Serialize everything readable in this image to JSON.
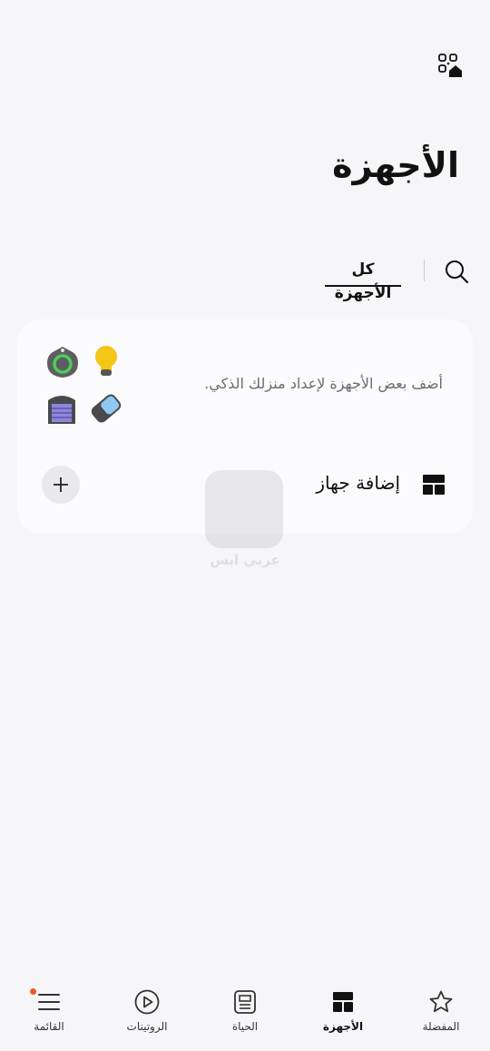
{
  "header": {
    "title": "الأجهزة",
    "qr_action_icon": "qr-home-icon",
    "search_icon": "search-icon"
  },
  "tabs": {
    "active_label": "كل الأجهزة"
  },
  "empty_card": {
    "hint": "أضف بعض الأجهزة لإعداد منزلك الذكي.",
    "device_icons": [
      "bulb-icon",
      "sensor-icon",
      "lock-card-icon",
      "garage-icon"
    ],
    "add_label": "إضافة جهاز",
    "add_icon": "devices-grid-icon",
    "plus_icon": "plus-icon"
  },
  "watermark": {
    "text": "عربي ابس"
  },
  "bottom_nav": {
    "items": [
      {
        "label": "المفضلة",
        "icon": "star-icon"
      },
      {
        "label": "الأجهزة",
        "icon": "devices-icon",
        "active": true
      },
      {
        "label": "الحياة",
        "icon": "life-icon"
      },
      {
        "label": "الروتينات",
        "icon": "play-icon"
      },
      {
        "label": "القائمة",
        "icon": "menu-icon",
        "badge": true
      }
    ]
  },
  "colors": {
    "background": "#f6f6f8",
    "card": "#fbfbfd",
    "accent_badge": "#f05a22",
    "bulb": "#f5c518",
    "sensor_ring": "#4ecb5a",
    "garage": "#8e86d8"
  }
}
